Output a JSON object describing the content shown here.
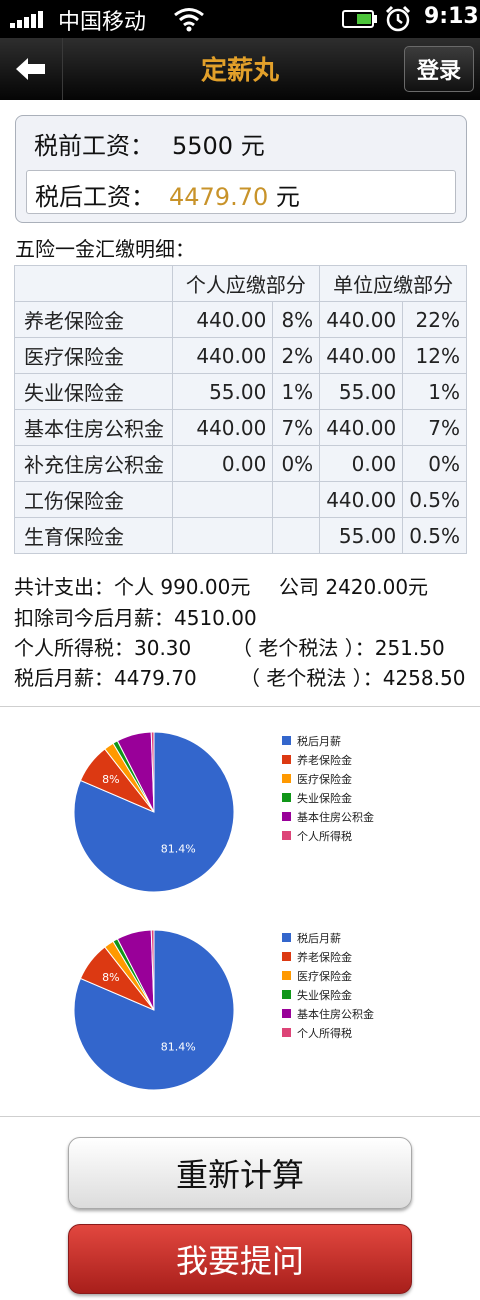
{
  "status_bar": {
    "carrier": "中国移动",
    "time": "9:13"
  },
  "header": {
    "title": "定薪丸",
    "login_label": "登录"
  },
  "salary": {
    "pre_tax_label": "税前工资：",
    "pre_tax_value": "5500 元",
    "after_tax_label": "税后工资：",
    "after_tax_value": "4479.70",
    "after_tax_unit": "元"
  },
  "detail": {
    "title": "五险一金汇缴明细：",
    "headers": {
      "personal": "个人应缴部分",
      "company": "单位应缴部分"
    },
    "rows": [
      {
        "name": "养老保险金",
        "personal_amount": "440.00",
        "personal_rate": "8%",
        "company_amount": "440.00",
        "company_rate": "22%"
      },
      {
        "name": "医疗保险金",
        "personal_amount": "440.00",
        "personal_rate": "2%",
        "company_amount": "440.00",
        "company_rate": "12%"
      },
      {
        "name": "失业保险金",
        "personal_amount": "55.00",
        "personal_rate": "1%",
        "company_amount": "55.00",
        "company_rate": "1%"
      },
      {
        "name": "基本住房公积金",
        "personal_amount": "440.00",
        "personal_rate": "7%",
        "company_amount": "440.00",
        "company_rate": "7%"
      },
      {
        "name": "补充住房公积金",
        "personal_amount": "0.00",
        "personal_rate": "0%",
        "company_amount": "0.00",
        "company_rate": "0%"
      },
      {
        "name": "工伤保险金",
        "personal_amount": "",
        "personal_rate": "",
        "company_amount": "440.00",
        "company_rate": "0.5%"
      },
      {
        "name": "生育保险金",
        "personal_amount": "",
        "personal_rate": "",
        "company_amount": "55.00",
        "company_rate": "0.5%"
      }
    ]
  },
  "summary": {
    "total_personal": "共计支出：个人 990.00元",
    "total_company": "公司  2420.00元",
    "after_deduction": "扣除司今后月薪：4510.00",
    "income_tax": "个人所得税：30.30",
    "old_tax": "（ 老个税法 ）：251.50",
    "after_tax_monthly": "税后月薪：4479.70",
    "old_after_tax": "（ 老个税法 ）：4258.50"
  },
  "chart_data": [
    {
      "type": "pie",
      "categories": [
        "税后月薪",
        "养老保险金",
        "医疗保险金",
        "失业保险金",
        "基本住房公积金",
        "个人所得税"
      ],
      "values": [
        4479.7,
        440.0,
        110.0,
        55.0,
        385.0,
        30.3
      ],
      "slice_labels": [
        "81.4%",
        "8%",
        "",
        "",
        "",
        ""
      ],
      "colors": [
        "#3366cc",
        "#dc3912",
        "#ff9900",
        "#109618",
        "#990099",
        "#dd4477"
      ],
      "legend": "right"
    },
    {
      "type": "pie",
      "categories": [
        "税后月薪",
        "养老保险金",
        "医疗保险金",
        "失业保险金",
        "基本住房公积金",
        "个人所得税"
      ],
      "values": [
        4479.7,
        440.0,
        110.0,
        55.0,
        385.0,
        30.3
      ],
      "slice_labels": [
        "81.4%",
        "8%",
        "",
        "",
        "",
        ""
      ],
      "colors": [
        "#3366cc",
        "#dc3912",
        "#ff9900",
        "#109618",
        "#990099",
        "#dd4477"
      ],
      "legend": "right"
    }
  ],
  "buttons": {
    "recalculate": "重新计算",
    "ask": "我要提问"
  },
  "colors": {
    "title_accent": "#e2a02a",
    "after_tax_value": "#c8932a",
    "ask_button": "#c0302a"
  },
  "icons": {
    "back": "arrow-left-icon",
    "signal": "signal-icon",
    "wifi": "wifi-icon",
    "battery": "battery-icon",
    "alarm": "alarm-icon"
  }
}
